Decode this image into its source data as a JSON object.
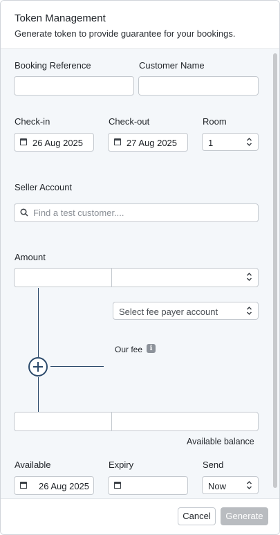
{
  "header": {
    "title": "Token Management",
    "subtitle": "Generate token to provide guarantee for your bookings."
  },
  "form": {
    "booking_reference": {
      "label": "Booking Reference",
      "value": ""
    },
    "customer_name": {
      "label": "Customer Name",
      "value": ""
    },
    "check_in": {
      "label": "Check-in",
      "value": "26 Aug 2025"
    },
    "check_out": {
      "label": "Check-out",
      "value": "27 Aug 2025"
    },
    "room": {
      "label": "Room",
      "value": "1"
    },
    "seller_account": {
      "label": "Seller Account",
      "placeholder": "Find a test customer...."
    },
    "amount": {
      "label": "Amount",
      "value": "",
      "currency": ""
    },
    "fee_payer": {
      "placeholder": "Select fee payer account"
    },
    "our_fee": {
      "label": "Our fee",
      "info_glyph": "i"
    },
    "balance": {
      "label": "Available balance",
      "value": "",
      "currency": ""
    },
    "available": {
      "label": "Available",
      "value": "26 Aug 2025"
    },
    "expiry": {
      "label": "Expiry",
      "value": ""
    },
    "send": {
      "label": "Send",
      "value": "Now"
    }
  },
  "footer": {
    "cancel_label": "Cancel",
    "generate_label": "Generate"
  },
  "icons": {
    "calendar": "calendar-icon",
    "search": "search-icon",
    "chevron": "chevron-updown-icon",
    "info": "info-icon",
    "plus": "plus-circle-icon"
  },
  "colors": {
    "accent_line": "#2b4a6b",
    "form_bg": "#f4f7fa",
    "disabled_button": "#b9bcc0"
  }
}
